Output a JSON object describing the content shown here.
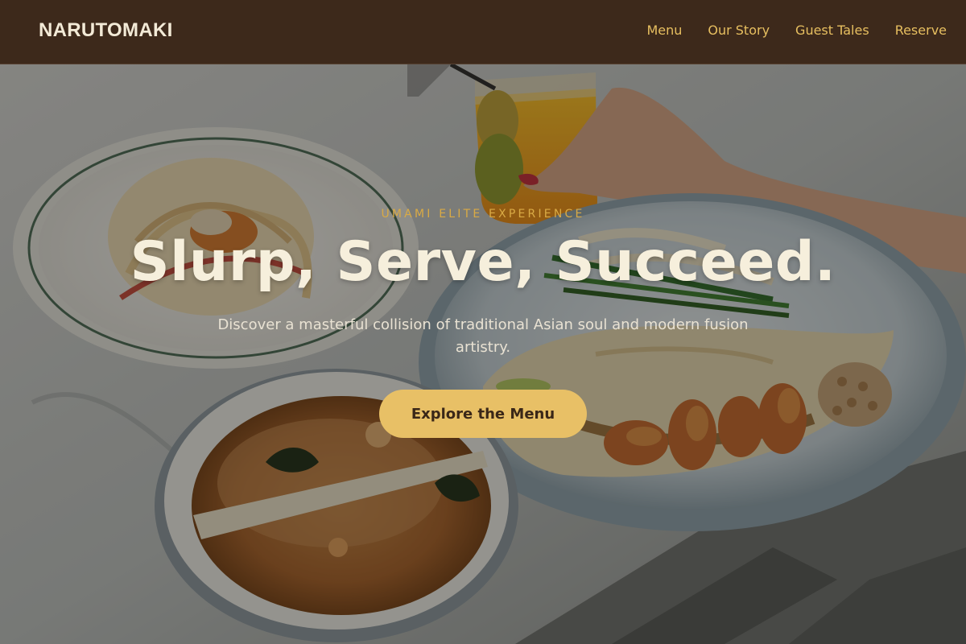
{
  "nav": {
    "brand": "NARUTOMAKI",
    "links": [
      "Menu",
      "Our Story",
      "Guest Tales",
      "Reserve"
    ]
  },
  "hero": {
    "eyebrow": "UMAMI ELITE EXPERIENCE",
    "headline": "Slurp, Serve, Succeed.",
    "subtitle": "Discover a masterful collision of traditional Asian soul and modern fusion artistry.",
    "cta_label": "Explore the Menu"
  },
  "colors": {
    "nav_background": "#3d291b",
    "nav_link": "#e7bf60",
    "eyebrow": "#d9aa45",
    "headline": "#f6efdc",
    "cta_background": "#e8c066",
    "cta_text": "#3a2718"
  }
}
